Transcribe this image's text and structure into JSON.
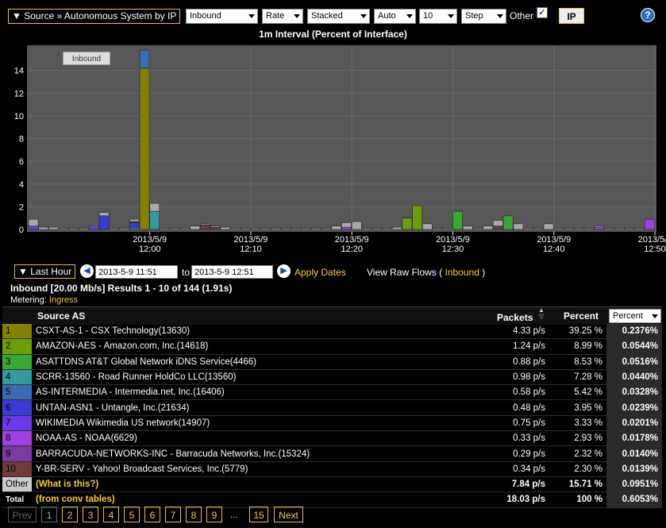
{
  "toolbar": {
    "breadcrumb": "Source » Autonomous System by IP",
    "direction": "Inbound",
    "metric": "Rate",
    "mode": "Stacked",
    "scale": "Auto",
    "top_n": "10",
    "style": "Step",
    "other_label": "Other",
    "other_checked": true,
    "ip_button": "IP",
    "help": "?"
  },
  "chart": {
    "title": "1m Interval (Percent of Interface)",
    "legend_button": "Inbound"
  },
  "chart_data": {
    "type": "bar",
    "stacked": true,
    "title": "1m Interval (Percent of Interface)",
    "ylim": [
      0,
      16
    ],
    "yticks": [
      0,
      2,
      4,
      6,
      8,
      10,
      12,
      14
    ],
    "xticks": [
      {
        "date": "2013/5/9",
        "time": "12:00",
        "t": 12
      },
      {
        "date": "2013/5/9",
        "time": "12:10",
        "t": 22
      },
      {
        "date": "2013/5/9",
        "time": "12:20",
        "t": 32
      },
      {
        "date": "2013/5/9",
        "time": "12:30",
        "t": 42
      },
      {
        "date": "2013/5/9",
        "time": "12:40",
        "t": 52
      },
      {
        "date": "2013/5/9",
        "time": "12:50",
        "t": 62
      }
    ],
    "series_colors": [
      "#828200",
      "#6b9e0a",
      "#3aa832",
      "#36999e",
      "#3a6bb5",
      "#3a3ad6",
      "#6b3ae6",
      "#a040e0",
      "#7a3a9e",
      "#6e3a3a",
      "#a8a8a8"
    ],
    "bars": [
      {
        "t": 0,
        "s": [
          0,
          0,
          0,
          0,
          0,
          0,
          0.3,
          0,
          0,
          0,
          0.6
        ]
      },
      {
        "t": 1,
        "s": [
          0,
          0,
          0,
          0,
          0,
          0,
          0,
          0,
          0,
          0,
          0.2
        ]
      },
      {
        "t": 2,
        "s": [
          0,
          0,
          0,
          0,
          0,
          0,
          0,
          0,
          0,
          0,
          0.2
        ]
      },
      {
        "t": 3,
        "s": [
          0,
          0,
          0,
          0,
          0,
          0,
          0,
          0,
          0,
          0,
          0.1
        ]
      },
      {
        "t": 4,
        "s": [
          0,
          0,
          0,
          0,
          0,
          0,
          0,
          0,
          0,
          0,
          0.1
        ]
      },
      {
        "t": 5,
        "s": [
          0,
          0,
          0,
          0,
          0,
          0,
          0,
          0,
          0,
          0,
          0.1
        ]
      },
      {
        "t": 6,
        "s": [
          0,
          0,
          0,
          0,
          0,
          0,
          0.3,
          0,
          0,
          0,
          0.1
        ]
      },
      {
        "t": 7,
        "s": [
          0,
          0,
          0,
          0,
          0,
          1.2,
          0,
          0,
          0,
          0,
          0.3
        ]
      },
      {
        "t": 8,
        "s": [
          0,
          0,
          0,
          0,
          0,
          0,
          0,
          0,
          0,
          0,
          0.1
        ]
      },
      {
        "t": 9,
        "s": [
          0,
          0,
          0,
          0,
          0,
          0,
          0,
          0,
          0,
          0,
          0.1
        ]
      },
      {
        "t": 10,
        "s": [
          0,
          0,
          0,
          0,
          0.2,
          0.4,
          0,
          0,
          0,
          0.1,
          0.2
        ]
      },
      {
        "t": 11,
        "s": [
          14.2,
          0,
          0,
          0,
          1.6,
          0,
          0,
          0,
          0,
          0,
          0
        ]
      },
      {
        "t": 12,
        "s": [
          0,
          0,
          0,
          1.6,
          0,
          0,
          0,
          0,
          0,
          0,
          0.7
        ]
      },
      {
        "t": 13,
        "s": [
          0,
          0,
          0,
          0,
          0,
          0,
          0,
          0,
          0,
          0,
          0.1
        ]
      },
      {
        "t": 14,
        "s": [
          0,
          0,
          0,
          0,
          0,
          0,
          0,
          0,
          0,
          0,
          0.1
        ]
      },
      {
        "t": 15,
        "s": [
          0,
          0,
          0,
          0,
          0,
          0,
          0,
          0,
          0,
          0,
          0.1
        ]
      },
      {
        "t": 16,
        "s": [
          0,
          0,
          0,
          0,
          0,
          0,
          0,
          0,
          0,
          0,
          0.3
        ]
      },
      {
        "t": 17,
        "s": [
          0,
          0,
          0,
          0,
          0,
          0,
          0,
          0,
          0,
          0.4,
          0.1
        ]
      },
      {
        "t": 18,
        "s": [
          0,
          0,
          0,
          0,
          0,
          0,
          0,
          0,
          0,
          0.2,
          0.1
        ]
      },
      {
        "t": 19,
        "s": [
          0,
          0,
          0,
          0,
          0,
          0,
          0,
          0,
          0,
          0,
          0.2
        ]
      },
      {
        "t": 20,
        "s": [
          0,
          0,
          0,
          0,
          0,
          0,
          0,
          0,
          0,
          0,
          0.1
        ]
      },
      {
        "t": 21,
        "s": [
          0,
          0,
          0,
          0,
          0,
          0,
          0,
          0,
          0,
          0,
          0.1
        ]
      },
      {
        "t": 22,
        "s": [
          0,
          0,
          0,
          0,
          0,
          0,
          0,
          0,
          0,
          0,
          0.1
        ]
      },
      {
        "t": 23,
        "s": [
          0,
          0,
          0,
          0,
          0,
          0,
          0,
          0,
          0,
          0,
          0.1
        ]
      },
      {
        "t": 24,
        "s": [
          0,
          0,
          0,
          0,
          0,
          0,
          0,
          0,
          0,
          0,
          0.1
        ]
      },
      {
        "t": 25,
        "s": [
          0,
          0,
          0,
          0,
          0,
          0,
          0,
          0,
          0,
          0,
          0.1
        ]
      },
      {
        "t": 26,
        "s": [
          0,
          0,
          0,
          0,
          0,
          0,
          0,
          0,
          0,
          0,
          0.1
        ]
      },
      {
        "t": 27,
        "s": [
          0,
          0,
          0,
          0,
          0,
          0,
          0,
          0,
          0,
          0,
          0.1
        ]
      },
      {
        "t": 28,
        "s": [
          0,
          0,
          0,
          0,
          0,
          0,
          0,
          0,
          0,
          0,
          0.1
        ]
      },
      {
        "t": 29,
        "s": [
          0,
          0,
          0,
          0,
          0,
          0,
          0,
          0,
          0,
          0,
          0.1
        ]
      },
      {
        "t": 30,
        "s": [
          0,
          0,
          0,
          0,
          0,
          0,
          0,
          0,
          0,
          0,
          0.3
        ]
      },
      {
        "t": 31,
        "s": [
          0,
          0,
          0,
          0,
          0,
          0,
          0,
          0.2,
          0,
          0,
          0.4
        ]
      },
      {
        "t": 32,
        "s": [
          0,
          0,
          0,
          0,
          0,
          0,
          0,
          0,
          0,
          0,
          0.7
        ]
      },
      {
        "t": 33,
        "s": [
          0,
          0,
          0,
          0,
          0,
          0,
          0,
          0,
          0,
          0,
          0.1
        ]
      },
      {
        "t": 34,
        "s": [
          0,
          0,
          0,
          0,
          0,
          0,
          0,
          0,
          0,
          0,
          0.1
        ]
      },
      {
        "t": 35,
        "s": [
          0,
          0,
          0,
          0,
          0,
          0,
          0,
          0,
          0,
          0,
          0.1
        ]
      },
      {
        "t": 36,
        "s": [
          0,
          0,
          0,
          0,
          0,
          0,
          0,
          0,
          0,
          0,
          0.2
        ]
      },
      {
        "t": 37,
        "s": [
          0,
          1.0,
          0,
          0,
          0,
          0,
          0,
          0,
          0,
          0,
          0
        ]
      },
      {
        "t": 38,
        "s": [
          0,
          2.1,
          0,
          0,
          0,
          0,
          0,
          0,
          0,
          0,
          0
        ]
      },
      {
        "t": 39,
        "s": [
          0,
          0,
          0,
          0,
          0,
          0,
          0,
          0,
          0,
          0,
          0.5
        ]
      },
      {
        "t": 40,
        "s": [
          0,
          0,
          0,
          0,
          0,
          0,
          0,
          0,
          0,
          0,
          0.1
        ]
      },
      {
        "t": 41,
        "s": [
          0,
          0,
          0,
          0,
          0,
          0,
          0,
          0,
          0,
          0,
          0.1
        ]
      },
      {
        "t": 42,
        "s": [
          0,
          0,
          1.6,
          0,
          0,
          0,
          0,
          0,
          0,
          0,
          0
        ]
      },
      {
        "t": 43,
        "s": [
          0,
          0,
          0,
          0,
          0,
          0,
          0,
          0,
          0,
          0,
          0.3
        ]
      },
      {
        "t": 44,
        "s": [
          0,
          0,
          0,
          0,
          0,
          0,
          0,
          0,
          0,
          0,
          0.1
        ]
      },
      {
        "t": 45,
        "s": [
          0,
          0,
          0,
          0,
          0,
          0,
          0,
          0,
          0,
          0,
          0.3
        ]
      },
      {
        "t": 46,
        "s": [
          0,
          0,
          0,
          0,
          0,
          0,
          0,
          0,
          0,
          0.3,
          0.5
        ]
      },
      {
        "t": 47,
        "s": [
          0,
          0,
          1.2,
          0,
          0,
          0,
          0,
          0,
          0,
          0,
          0
        ]
      },
      {
        "t": 48,
        "s": [
          0,
          0,
          0,
          0,
          0,
          0,
          0,
          0,
          0,
          0,
          0.5
        ]
      },
      {
        "t": 49,
        "s": [
          0,
          0,
          0,
          0,
          0,
          0,
          0,
          0,
          0,
          0,
          0.1
        ]
      },
      {
        "t": 50,
        "s": [
          0,
          0,
          0,
          0,
          0,
          0,
          0,
          0,
          0,
          0,
          0.1
        ]
      },
      {
        "t": 51,
        "s": [
          0,
          0,
          0,
          0,
          0,
          0,
          0,
          0,
          0,
          0,
          0.5
        ]
      },
      {
        "t": 52,
        "s": [
          0,
          0,
          0,
          0,
          0,
          0,
          0,
          0,
          0,
          0,
          0.1
        ]
      },
      {
        "t": 53,
        "s": [
          0,
          0,
          0,
          0,
          0,
          0,
          0,
          0,
          0,
          0,
          0.1
        ]
      },
      {
        "t": 54,
        "s": [
          0,
          0,
          0,
          0,
          0,
          0,
          0,
          0,
          0,
          0,
          0.1
        ]
      },
      {
        "t": 55,
        "s": [
          0,
          0,
          0,
          0,
          0,
          0,
          0,
          0,
          0,
          0,
          0.1
        ]
      },
      {
        "t": 56,
        "s": [
          0,
          0,
          0,
          0,
          0,
          0,
          0,
          0.2,
          0,
          0,
          0.1
        ]
      },
      {
        "t": 57,
        "s": [
          0,
          0,
          0,
          0,
          0,
          0,
          0,
          0,
          0,
          0,
          0.1
        ]
      },
      {
        "t": 58,
        "s": [
          0,
          0,
          0,
          0,
          0,
          0,
          0,
          0,
          0,
          0,
          0.1
        ]
      },
      {
        "t": 59,
        "s": [
          0,
          0,
          0,
          0,
          0,
          0,
          0,
          0,
          0,
          0,
          0.1
        ]
      },
      {
        "t": 60,
        "s": [
          0,
          0,
          0,
          0,
          0,
          0,
          0,
          0,
          0,
          0,
          0.1
        ]
      },
      {
        "t": 61,
        "s": [
          0,
          0,
          0,
          0,
          0,
          0,
          0,
          0.9,
          0,
          0,
          0
        ]
      }
    ]
  },
  "range": {
    "button": "Last Hour",
    "from": "2013-5-9 11:51",
    "to_label": "to",
    "to": "2013-5-9 12:51",
    "apply": "Apply Dates",
    "raw_prefix": "View Raw Flows (",
    "raw_link": "Inbound",
    "raw_suffix": ")"
  },
  "summary": {
    "line": "Inbound [20.00 Mb/s] Results 1 - 10 of 144 (1.91s)",
    "metering_label": "Metering:",
    "metering_value": "Ingress"
  },
  "table": {
    "col_source": "Source AS",
    "col_packets": "Packets",
    "col_percent": "Percent",
    "col_percent_select": "Percent",
    "rows": [
      {
        "rank": "1",
        "color": "#828200",
        "name": "CSXT-AS-1 - CSX Technology(13630)",
        "packets": "4.33 p/s",
        "percent": "39.25 %",
        "percent2": "0.2376%"
      },
      {
        "rank": "2",
        "color": "#6b9e0a",
        "name": "AMAZON-AES - Amazon.com, Inc.(14618)",
        "packets": "1.24 p/s",
        "percent": "8.99 %",
        "percent2": "0.0544%"
      },
      {
        "rank": "3",
        "color": "#3aa832",
        "name": "ASATTDNS AT&T Global Network iDNS Service(4466)",
        "packets": "0.88 p/s",
        "percent": "8.53 %",
        "percent2": "0.0516%"
      },
      {
        "rank": "4",
        "color": "#36999e",
        "name": "SCRR-13560 - Road Runner HoldCo LLC(13560)",
        "packets": "0.98 p/s",
        "percent": "7.28 %",
        "percent2": "0.0440%"
      },
      {
        "rank": "5",
        "color": "#3a6bb5",
        "name": "AS-INTERMEDIA - Intermedia.net, Inc.(16406)",
        "packets": "0.58 p/s",
        "percent": "5.42 %",
        "percent2": "0.0328%"
      },
      {
        "rank": "6",
        "color": "#3a3ad6",
        "name": "UNTAN-ASN1 - Untangle, Inc.(21634)",
        "packets": "0.48 p/s",
        "percent": "3.95 %",
        "percent2": "0.0239%"
      },
      {
        "rank": "7",
        "color": "#6b3ae6",
        "name": "WIKIMEDIA Wikimedia US network(14907)",
        "packets": "0.75 p/s",
        "percent": "3.33 %",
        "percent2": "0.0201%"
      },
      {
        "rank": "8",
        "color": "#a040e0",
        "name": "NOAA-AS - NOAA(6629)",
        "packets": "0.33 p/s",
        "percent": "2.93 %",
        "percent2": "0.0178%"
      },
      {
        "rank": "9",
        "color": "#7a3a9e",
        "name": "BARRACUDA-NETWORKS-INC - Barracuda Networks, Inc.(15324)",
        "packets": "0.29 p/s",
        "percent": "2.32 %",
        "percent2": "0.0140%"
      },
      {
        "rank": "10",
        "color": "#6e3a3a",
        "name": "Y-BR-SERV - Yahoo! Broadcast Services, Inc.(5779)",
        "packets": "0.34 p/s",
        "percent": "2.30 %",
        "percent2": "0.0139%"
      }
    ],
    "other": {
      "label": "Other",
      "name": "(What is this?)",
      "packets": "7.84 p/s",
      "percent": "15.71 %",
      "percent2": "0.0951%"
    },
    "total": {
      "label": "Total",
      "name": "(from conv tables)",
      "packets": "18.03 p/s",
      "percent": "100 %",
      "percent2": "0.6053%"
    }
  },
  "pagination": {
    "prev": "Prev",
    "pages": [
      "1",
      "2",
      "3",
      "4",
      "5",
      "6",
      "7",
      "8",
      "9"
    ],
    "ellipsis": "...",
    "last": "15",
    "next": "Next",
    "current": "1"
  }
}
